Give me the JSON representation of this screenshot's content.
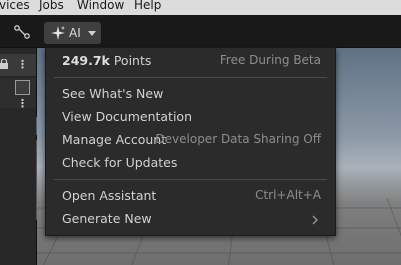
{
  "menubar": {
    "items": [
      "vices",
      "Jobs",
      "Window",
      "Help"
    ]
  },
  "toolbar": {
    "ai_button_label": "AI"
  },
  "menu": {
    "points_value": "249.7k",
    "points_label": "Points",
    "plan_status": "Free During Beta",
    "items": [
      {
        "label": "See What's New"
      },
      {
        "label": "View Documentation"
      },
      {
        "label": "Manage Account",
        "note": "Developer Data Sharing Off"
      },
      {
        "label": "Check for Updates"
      },
      {
        "label": "Open Assistant",
        "shortcut": "Ctrl+Alt+A"
      },
      {
        "label": "Generate New"
      }
    ]
  },
  "colors": {
    "menu_bg": "#2b2b2b",
    "menubar_bg": "#dcdcdc",
    "toolbar_bg": "#191919",
    "button_bg": "#3f3f3f",
    "muted_text": "#8d8d8d"
  }
}
